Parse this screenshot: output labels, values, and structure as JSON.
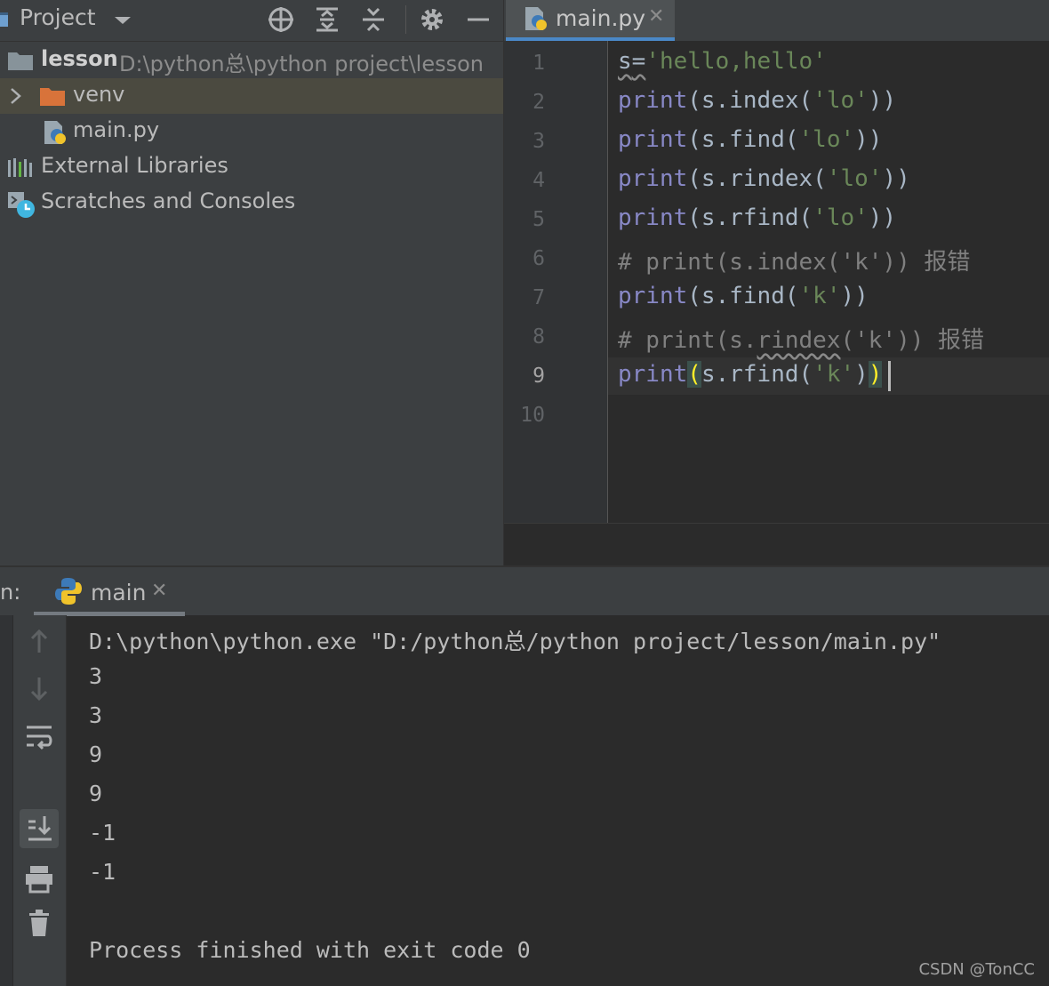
{
  "project": {
    "title": "Project",
    "tree": [
      {
        "name": "lesson",
        "path": "D:\\python总\\python project\\lesson"
      },
      {
        "name": "venv"
      },
      {
        "name": "main.py"
      },
      {
        "name": "External Libraries"
      },
      {
        "name": "Scratches and Consoles"
      }
    ]
  },
  "editor": {
    "tab": {
      "label": "main.py"
    },
    "line_numbers": [
      "1",
      "2",
      "3",
      "4",
      "5",
      "6",
      "7",
      "8",
      "9",
      "10"
    ],
    "current_line": 9,
    "code": {
      "l1": {
        "var": "s",
        "eq": "=",
        "str": "'hello,hello'"
      },
      "l2": {
        "fn": "print",
        "rest": "(s.index(",
        "str": "'lo'",
        "end": "))"
      },
      "l3": {
        "fn": "print",
        "rest": "(s.find(",
        "str": "'lo'",
        "end": "))"
      },
      "l4": {
        "fn": "print",
        "rest": "(s.rindex(",
        "str": "'lo'",
        "end": "))"
      },
      "l5": {
        "fn": "print",
        "rest": "(s.rfind(",
        "str": "'lo'",
        "end": "))"
      },
      "l6": {
        "comment": "# print(s.index('k')) 报错"
      },
      "l7": {
        "fn": "print",
        "rest": "(s.find(",
        "str": "'k'",
        "end": "))"
      },
      "l8": {
        "c1": "# print(s.",
        "c2": "rindex",
        "c3": "('k')) 报错"
      },
      "l9": {
        "fn": "print",
        "open": "(",
        "rest": "s.rfind(",
        "str": "'k'",
        "mid": ")",
        "close": ")"
      }
    }
  },
  "run": {
    "prefix": "n:",
    "tab_label": "main",
    "output": [
      "D:\\python\\python.exe \"D:/python总/python project/lesson/main.py\"",
      "3",
      "3",
      "9",
      "9",
      "-1",
      "-1",
      "",
      "Process finished with exit code 0"
    ]
  },
  "watermark": "CSDN @TonCC",
  "colors": {
    "panel_bg": "#3c3f41",
    "editor_bg": "#2b2b2b",
    "keyword": "#8888c6",
    "string": "#6a8759",
    "comment": "#808080",
    "accent": "#4a88c7"
  },
  "icons": [
    "project-icon",
    "chevron-down-icon",
    "locate-icon",
    "expand-all-icon",
    "collapse-all-icon",
    "gear-icon",
    "minimize-icon",
    "folder-icon",
    "chevron-right-icon",
    "python-file-icon",
    "libraries-icon",
    "scratches-icon",
    "close-icon",
    "up-arrow-icon",
    "down-arrow-icon",
    "soft-wrap-icon",
    "scroll-to-end-icon",
    "print-icon",
    "trash-icon"
  ]
}
